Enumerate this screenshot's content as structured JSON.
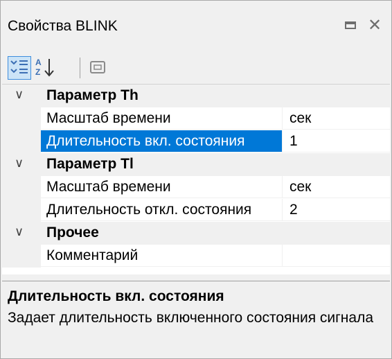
{
  "window": {
    "title": "Свойства BLINK",
    "maximize_icon": "maximize-icon",
    "close_glyph": "✕"
  },
  "toolbar": {
    "categorized_icon": "categorized-icon",
    "alphabetical_icon": "alphabetical-sort-icon",
    "property_pages_icon": "property-pages-icon",
    "accent_color": "#3e8ddd"
  },
  "grid": {
    "categories": [
      {
        "label": "Параметр Th",
        "rows": [
          {
            "name": "Масштаб времени",
            "value": "сек"
          },
          {
            "name": "Длительность вкл. состояния",
            "value": "1"
          }
        ]
      },
      {
        "label": "Параметр Tl",
        "rows": [
          {
            "name": "Масштаб времени",
            "value": "сек"
          },
          {
            "name": "Длительность откл. состояния",
            "value": "2"
          }
        ]
      },
      {
        "label": "Прочее",
        "rows": [
          {
            "name": "Комментарий",
            "value": ""
          }
        ]
      }
    ],
    "selected_color": "#0078d7"
  },
  "description": {
    "title": "Длительность вкл. состояния",
    "text": "Задает длительность включенного состояния сигнала"
  }
}
